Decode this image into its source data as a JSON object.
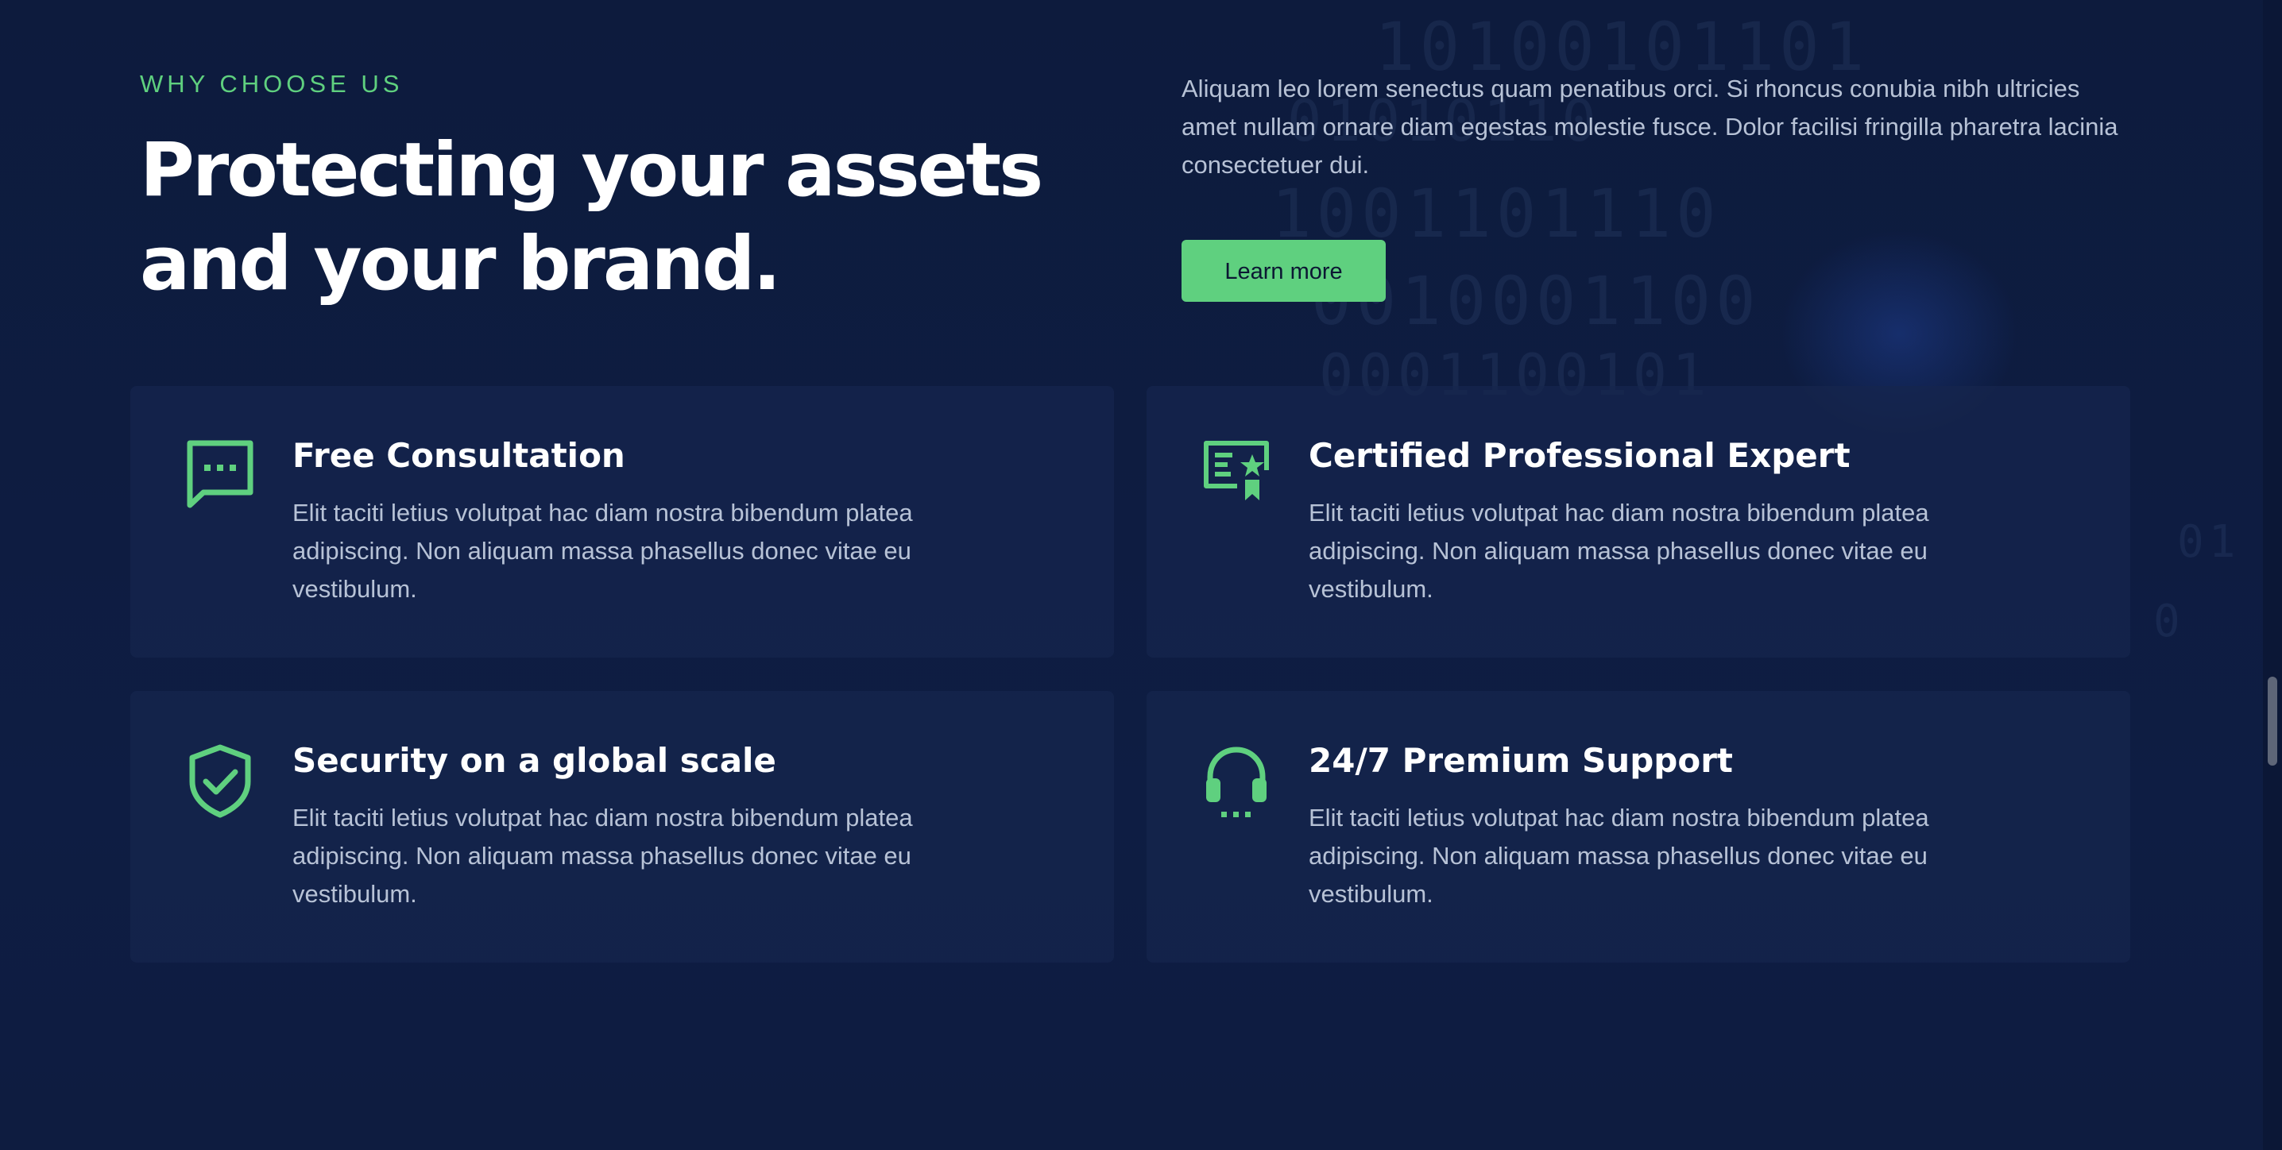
{
  "section": {
    "eyebrow": "WHY CHOOSE US",
    "headline": "Protecting your assets and your brand.",
    "intro": "Aliquam leo lorem senectus quam penatibus orci. Si rhoncus conubia nibh ultricies amet nullam ornare diam egestas molestie fusce. Dolor facilisi fringilla pharetra lacinia consectetuer dui.",
    "cta_label": "Learn more"
  },
  "features": [
    {
      "title": "Free Consultation",
      "description": "Elit taciti letius volutpat hac diam nostra bibendum platea adipiscing. Non aliquam massa phasellus donec vitae eu vestibulum.",
      "icon": "chat-bubble-icon"
    },
    {
      "title": "Certified Professional Expert",
      "description": "Elit taciti letius volutpat hac diam nostra bibendum platea adipiscing. Non aliquam massa phasellus donec vitae eu vestibulum.",
      "icon": "certificate-icon"
    },
    {
      "title": "Security on a global scale",
      "description": "Elit taciti letius volutpat hac diam nostra bibendum platea adipiscing. Non aliquam massa phasellus donec vitae eu vestibulum.",
      "icon": "shield-check-icon"
    },
    {
      "title": "24/7 Premium Support",
      "description": "Elit taciti letius volutpat hac diam nostra bibendum platea adipiscing. Non aliquam massa phasellus donec vitae eu vestibulum.",
      "icon": "headset-icon"
    }
  ],
  "colors": {
    "background": "#0d1b3d",
    "card": "#16264e",
    "accent": "#5fd07f",
    "heading": "#ffffff",
    "body_text": "#b7c2d6"
  }
}
